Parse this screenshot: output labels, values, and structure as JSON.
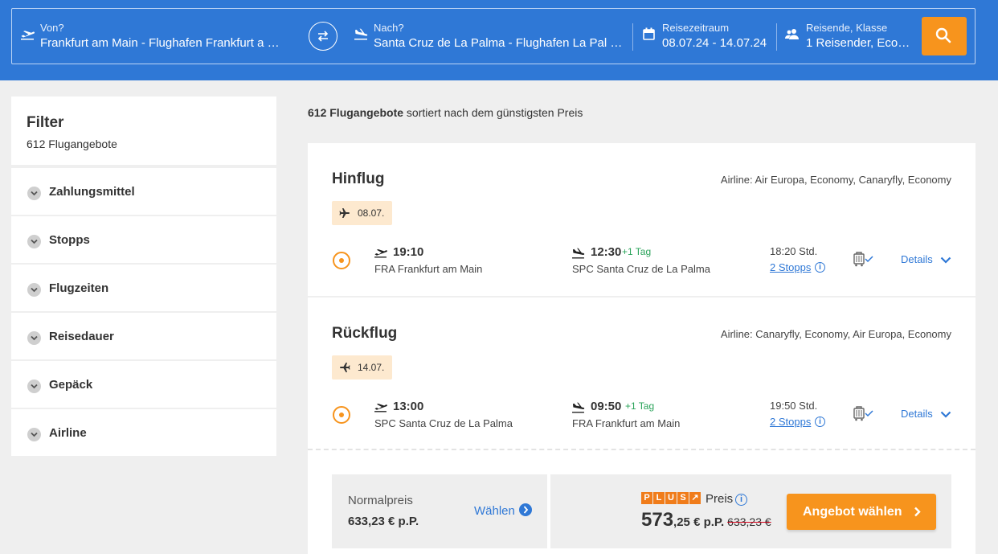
{
  "search": {
    "from_label": "Von?",
    "from_value": "Frankfurt am Main - Flughafen Frankfurt a …",
    "to_label": "Nach?",
    "to_value": "Santa Cruz de La Palma - Flughafen La Pal …",
    "period_label": "Reisezeitraum",
    "period_value": "08.07.24 - 14.07.24",
    "travelers_label": "Reisende, Klasse",
    "travelers_value": "1 Reisender, Eco…",
    "icons": [
      "plane-departure-icon",
      "swap-icon",
      "plane-arrival-icon",
      "calendar-icon",
      "travelers-icon",
      "search-icon"
    ]
  },
  "sidebar": {
    "title": "Filter",
    "count": "612 Flugangebote",
    "items": [
      {
        "label": "Zahlungsmittel"
      },
      {
        "label": "Stopps"
      },
      {
        "label": "Flugzeiten"
      },
      {
        "label": "Reisedauer"
      },
      {
        "label": "Gepäck"
      },
      {
        "label": "Airline"
      }
    ]
  },
  "summary": {
    "count_bold": "612 Flugangebote",
    "rest": " sortiert nach dem günstigsten Preis"
  },
  "legs": [
    {
      "title": "Hinflug",
      "airline": "Airline: Air Europa, Economy, Canaryfly, Economy",
      "date": "08.07.",
      "dep_time": "19:10",
      "dep_place": "FRA Frankfurt am Main",
      "arr_time": "12:30",
      "plus_day": "+1 Tag",
      "arr_place": "SPC Santa Cruz de La Palma",
      "duration": "18:20 Std.",
      "stops": "2 Stopps",
      "details": "Details"
    },
    {
      "title": "Rückflug",
      "airline": "Airline: Canaryfly, Economy, Air Europa, Economy",
      "date": "14.07.",
      "dep_time": "13:00",
      "dep_place": "SPC Santa Cruz de La Palma",
      "arr_time": "09:50",
      "plus_day": "+1 Tag",
      "arr_place": "FRA Frankfurt am Main",
      "duration": "19:50 Std.",
      "stops": "2 Stopps",
      "details": "Details"
    }
  ],
  "pricing": {
    "normal_label": "Normalpreis",
    "normal_price": "633,23 € p.P.",
    "select_label": "Wählen",
    "plus_letters": [
      "P",
      "L",
      "U",
      "S",
      "↗"
    ],
    "plus_word": "Preis",
    "plus_price_main": "573",
    "plus_price_rest": ",25 € p.P.",
    "plus_price_old": "633,23 €",
    "offer_button": "Angebot wählen"
  },
  "colors": {
    "header_blue": "#2f78d6",
    "accent_orange": "#f7941d",
    "plus_day_green": "#2aa35a",
    "badge_bg": "#fde9cf"
  }
}
